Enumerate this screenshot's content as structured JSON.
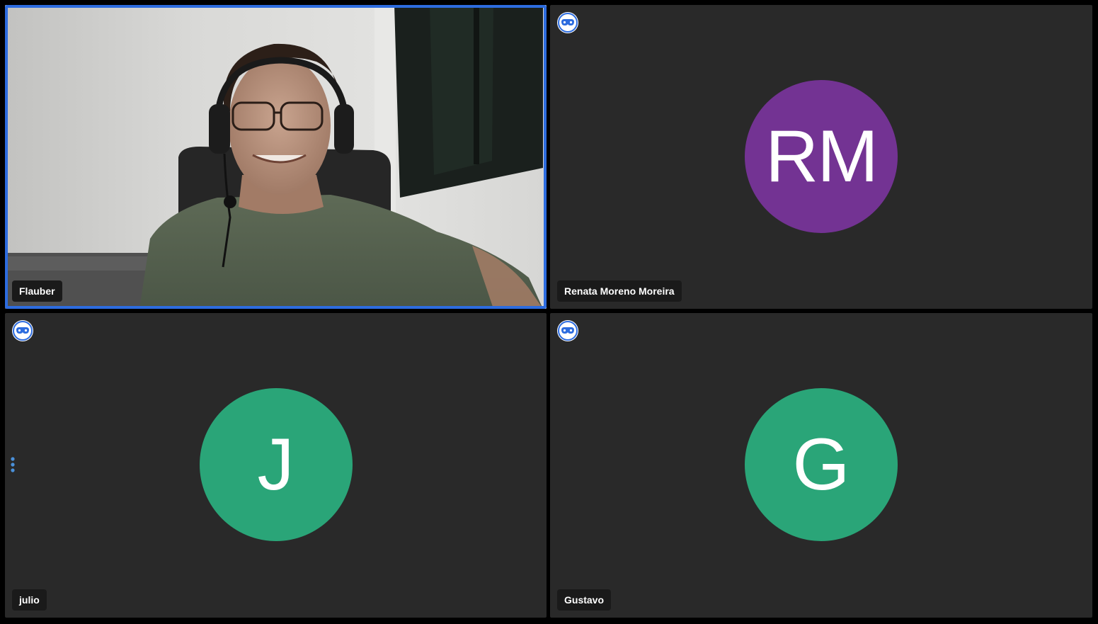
{
  "participants": [
    {
      "name": "Flauber",
      "video_on": true,
      "active_speaker": true
    },
    {
      "name": "Renata Moreno Moreira",
      "initials": "RM",
      "avatar_color": "#733393",
      "video_on": false,
      "icon": "incognito-mask-icon"
    },
    {
      "name": "julio",
      "initials": "J",
      "avatar_color": "#2aa578",
      "video_on": false,
      "icon": "incognito-mask-icon"
    },
    {
      "name": "Gustavo",
      "initials": "G",
      "avatar_color": "#2aa578",
      "video_on": false,
      "icon": "incognito-mask-icon"
    }
  ],
  "colors": {
    "background": "#000000",
    "tile": "#292929",
    "active_border": "#2d6cdf",
    "name_tag": "#1a1a1a",
    "dots": "#4a90d9"
  }
}
